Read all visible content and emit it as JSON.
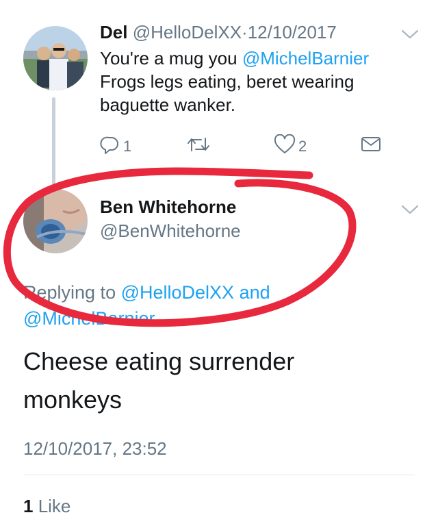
{
  "tweet1": {
    "name": "Del",
    "handle": "@HelloDelXX",
    "separator": "·",
    "date": "12/10/2017",
    "text_line1_prefix": "You're a mug you ",
    "text_line1_mention": "@MichelBarnier",
    "text_line2": "Frogs legs eating, beret wearing",
    "text_line3": "baguette wanker.",
    "reply_count": "1",
    "like_count": "2",
    "icons": [
      "reply-icon",
      "retweet-icon",
      "like-icon",
      "dm-icon",
      "chevron-down-icon"
    ]
  },
  "tweet2": {
    "name": "Ben Whitehorne",
    "handle": "@BenWhitehorne",
    "replying_prefix": "Replying to ",
    "replying_mention1": "@HelloDelXX",
    "replying_and": " and",
    "replying_mention2": "@MichelBarnier",
    "text_line1": "Cheese eating surrender",
    "text_line2": "monkeys",
    "timestamp": "12/10/2017, 23:52",
    "likes_count": "1",
    "likes_label": " Like"
  },
  "colors": {
    "link": "#1da1f2",
    "secondary_text": "#657786",
    "annotation_red": "#e8283c"
  }
}
